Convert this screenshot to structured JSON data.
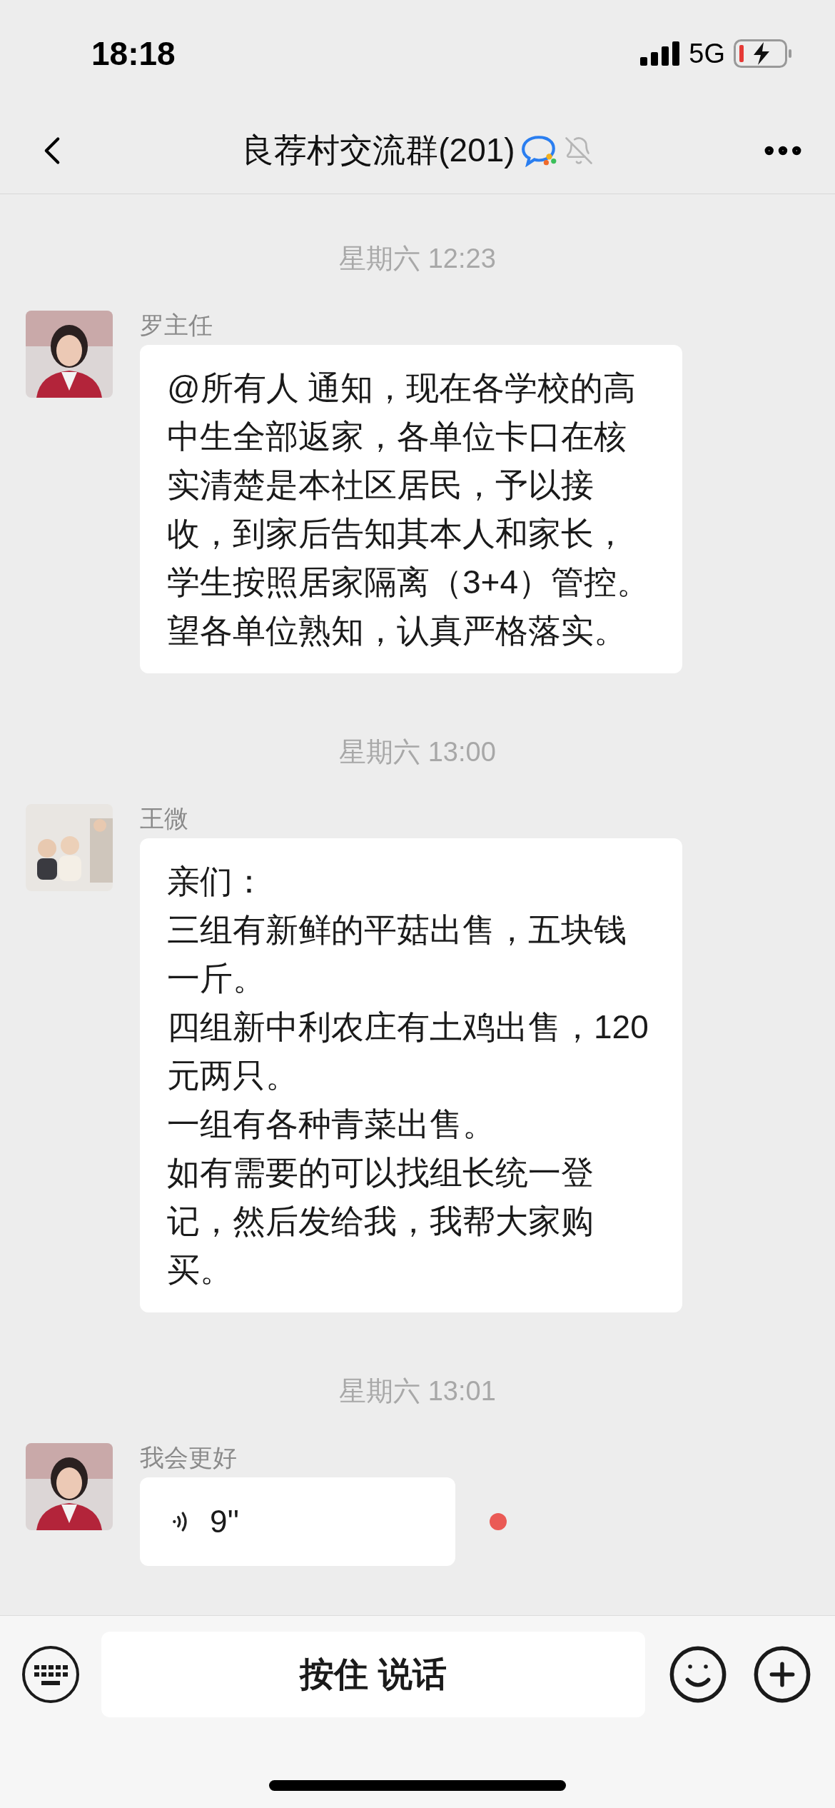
{
  "status_bar": {
    "time": "18:18",
    "network": "5G"
  },
  "header": {
    "title": "良荐村交流群(201)",
    "muted": true
  },
  "messages": [
    {
      "kind": "time",
      "text": "星期六 12:23"
    },
    {
      "kind": "text",
      "sender": "罗主任",
      "text": "@所有人 通知，现在各学校的高中生全部返家，各单位卡口在核实清楚是本社区居民，予以接收，到家后告知其本人和家长，学生按照居家隔离（3+4）管控。望各单位熟知，认真严格落实。"
    },
    {
      "kind": "time",
      "text": "星期六 13:00"
    },
    {
      "kind": "lines",
      "sender": "王微",
      "lines": [
        "亲们：",
        "三组有新鲜的平菇出售，五块钱一斤。",
        "四组新中利农庄有土鸡出售，120元两只。",
        "一组有各种青菜出售。",
        "如有需要的可以找组长统一登记，然后发给我，我帮大家购买。"
      ]
    },
    {
      "kind": "time",
      "text": "星期六 13:01"
    },
    {
      "kind": "voice",
      "sender": "我会更好",
      "duration": "9''",
      "unread": true
    }
  ],
  "input_bar": {
    "hold_to_talk": "按住 说话"
  }
}
